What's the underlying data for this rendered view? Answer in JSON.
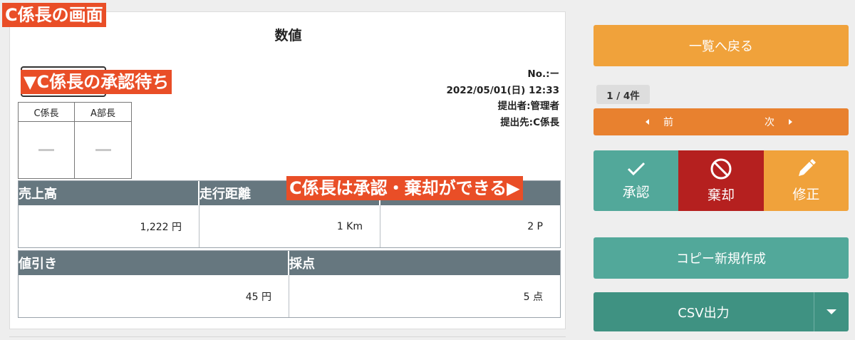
{
  "annotations": {
    "screen_label": "C係長の画面",
    "pending_label": "▼C係長の承認待ち",
    "can_approve_label": "C係長は承認・棄却ができる▶"
  },
  "document": {
    "title": "数値",
    "number": "No.:ー",
    "datetime": "2022/05/01(日) 12:33",
    "submitter": "提出者:管理者",
    "submit_to": "提出先:C係長"
  },
  "approval_table": {
    "columns": [
      {
        "role": "C係長",
        "stamp": "—"
      },
      {
        "role": "A部長",
        "stamp": "—"
      }
    ]
  },
  "fields": [
    {
      "label": "売上高",
      "value": "1,222 円"
    },
    {
      "label": "走行距離",
      "value": "1 Km"
    },
    {
      "label": "",
      "value": "2 P"
    },
    {
      "label": "値引き",
      "value": "45 円"
    },
    {
      "label": "採点",
      "value": "5 点"
    }
  ],
  "sidebar": {
    "back_label": "一覧へ戻る",
    "page_count": "1 / 4件",
    "prev_label": "前",
    "next_label": "次",
    "approve_label": "承認",
    "reject_label": "棄却",
    "edit_label": "修正",
    "copy_label": "コピー新規作成",
    "csv_label": "CSV出力"
  },
  "colors": {
    "orange": "#f0a23b",
    "nav_orange": "#e8812f",
    "teal": "#52a89a",
    "red": "#b5201f",
    "dark_teal": "#3f9282",
    "field_header": "#66777f",
    "annotation": "#e94e27"
  },
  "icons": {
    "approve": "check-icon",
    "reject": "prohibited-icon",
    "edit": "pencil-icon",
    "csv_menu": "caret-down-icon",
    "prev": "triangle-left-icon",
    "next": "triangle-right-icon"
  }
}
